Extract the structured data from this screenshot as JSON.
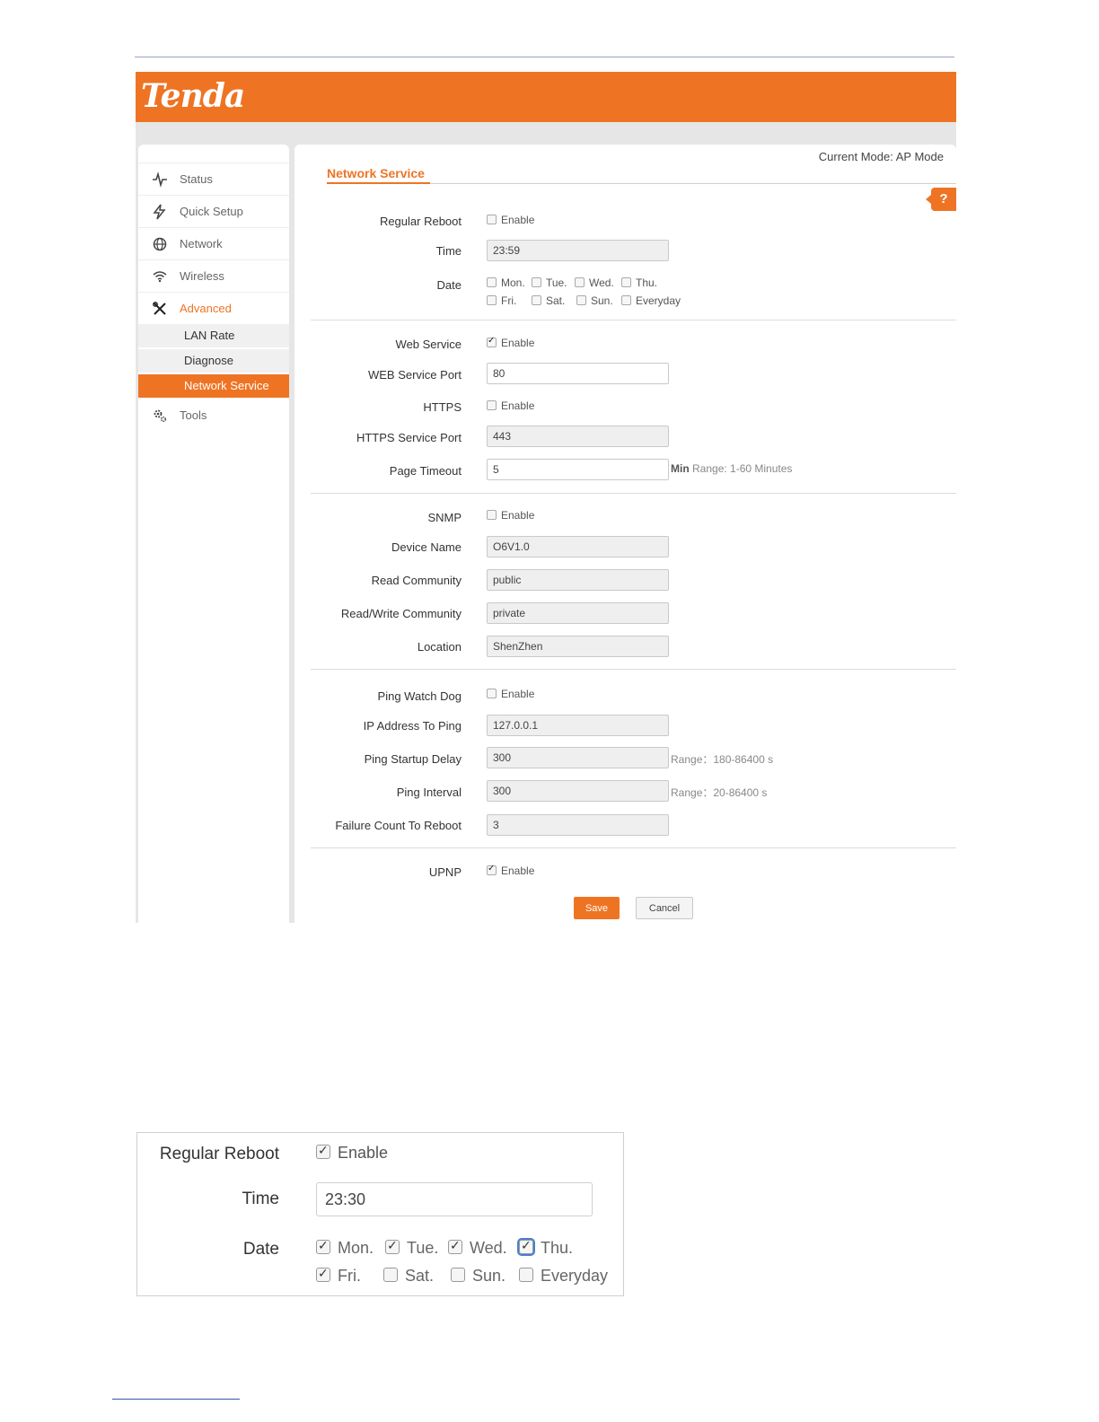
{
  "brand": {
    "logo_text": "Tenda",
    "accent": "#ee7424"
  },
  "sidebar": {
    "items": [
      {
        "label": "Status",
        "icon": "pulse-icon"
      },
      {
        "label": "Quick Setup",
        "icon": "bolt-icon"
      },
      {
        "label": "Network",
        "icon": "globe-icon"
      },
      {
        "label": "Wireless",
        "icon": "wifi-icon"
      },
      {
        "label": "Advanced",
        "icon": "tools-cross-icon",
        "active": true
      },
      {
        "label": "Tools",
        "icon": "gear-icon"
      }
    ],
    "sub_items": [
      {
        "label": "LAN Rate"
      },
      {
        "label": "Diagnose"
      },
      {
        "label": "Network Service",
        "selected": true
      }
    ]
  },
  "header": {
    "mode": "Current Mode: AP Mode",
    "title": "Network Service",
    "help": "?"
  },
  "form": {
    "enable_label": "Enable",
    "regular_reboot": {
      "label": "Regular Reboot",
      "enabled": false
    },
    "time": {
      "label": "Time",
      "value": "23:59"
    },
    "date": {
      "label": "Date",
      "days": [
        "Mon.",
        "Tue.",
        "Wed.",
        "Thu.",
        "Fri.",
        "Sat.",
        "Sun.",
        "Everyday"
      ]
    },
    "web_service": {
      "label": "Web Service",
      "enabled": true
    },
    "web_port": {
      "label": "WEB Service Port",
      "value": "80"
    },
    "https": {
      "label": "HTTPS",
      "enabled": false
    },
    "https_port": {
      "label": "HTTPS Service Port",
      "value": "443"
    },
    "page_timeout": {
      "label": "Page Timeout",
      "value": "5",
      "unit": "Min",
      "range": "Range: 1-60 Minutes"
    },
    "snmp": {
      "label": "SNMP",
      "enabled": false
    },
    "device_name": {
      "label": "Device Name",
      "value": "O6V1.0"
    },
    "read_community": {
      "label": "Read Community",
      "value": "public"
    },
    "rw_community": {
      "label": "Read/Write Community",
      "value": "private"
    },
    "location": {
      "label": "Location",
      "value": "ShenZhen"
    },
    "ping_watchdog": {
      "label": "Ping Watch Dog",
      "enabled": false
    },
    "ip_to_ping": {
      "label": "IP Address To Ping",
      "value": "127.0.0.1"
    },
    "ping_startup_delay": {
      "label": "Ping Startup Delay",
      "value": "300",
      "range": "Range：180-86400 s"
    },
    "ping_interval": {
      "label": "Ping Interval",
      "value": "300",
      "range": "Range：20-86400 s"
    },
    "failure_count": {
      "label": "Failure Count To Reboot",
      "value": "3"
    },
    "upnp": {
      "label": "UPNP",
      "enabled": true
    },
    "save_label": "Save",
    "cancel_label": "Cancel"
  },
  "zoom": {
    "regular_reboot": {
      "label": "Regular Reboot",
      "enabled": true
    },
    "enable_label": "Enable",
    "time": {
      "label": "Time",
      "value": "23:30"
    },
    "date": {
      "label": "Date",
      "days": [
        "Mon.",
        "Tue.",
        "Wed.",
        "Thu.",
        "Fri.",
        "Sat.",
        "Sun.",
        "Everyday"
      ],
      "checked": [
        true,
        true,
        true,
        true,
        true,
        false,
        false,
        false
      ]
    }
  }
}
